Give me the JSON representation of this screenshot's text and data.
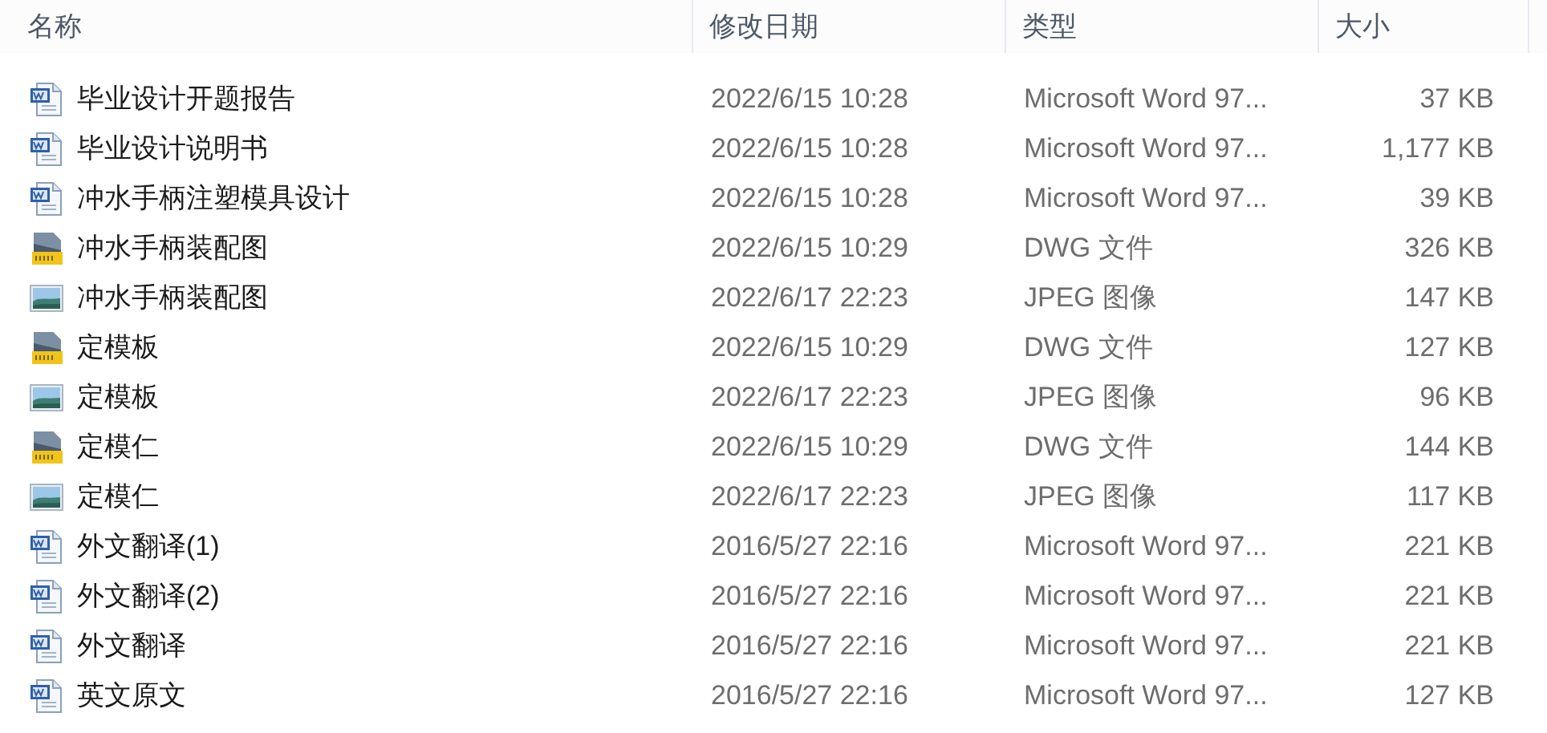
{
  "columns": [
    "名称",
    "修改日期",
    "类型",
    "大小"
  ],
  "files": [
    {
      "kind": "word",
      "name": "毕业设计开题报告",
      "modified": "2022/6/15 10:28",
      "type": "Microsoft Word 97...",
      "size": "37 KB"
    },
    {
      "kind": "word",
      "name": "毕业设计说明书",
      "modified": "2022/6/15 10:28",
      "type": "Microsoft Word 97...",
      "size": "1,177 KB"
    },
    {
      "kind": "word",
      "name": "冲水手柄注塑模具设计",
      "modified": "2022/6/15 10:28",
      "type": "Microsoft Word 97...",
      "size": "39 KB"
    },
    {
      "kind": "dwg",
      "name": "冲水手柄装配图",
      "modified": "2022/6/15 10:29",
      "type": "DWG 文件",
      "size": "326 KB"
    },
    {
      "kind": "jpeg",
      "name": "冲水手柄装配图",
      "modified": "2022/6/17 22:23",
      "type": "JPEG 图像",
      "size": "147 KB"
    },
    {
      "kind": "dwg",
      "name": "定模板",
      "modified": "2022/6/15 10:29",
      "type": "DWG 文件",
      "size": "127 KB"
    },
    {
      "kind": "jpeg",
      "name": "定模板",
      "modified": "2022/6/17 22:23",
      "type": "JPEG 图像",
      "size": "96 KB"
    },
    {
      "kind": "dwg",
      "name": "定模仁",
      "modified": "2022/6/15 10:29",
      "type": "DWG 文件",
      "size": "144 KB"
    },
    {
      "kind": "jpeg",
      "name": "定模仁",
      "modified": "2022/6/17 22:23",
      "type": "JPEG 图像",
      "size": "117 KB"
    },
    {
      "kind": "word",
      "name": "外文翻译(1)",
      "modified": "2016/5/27 22:16",
      "type": "Microsoft Word 97...",
      "size": "221 KB"
    },
    {
      "kind": "word",
      "name": "外文翻译(2)",
      "modified": "2016/5/27 22:16",
      "type": "Microsoft Word 97...",
      "size": "221 KB"
    },
    {
      "kind": "word",
      "name": "外文翻译",
      "modified": "2016/5/27 22:16",
      "type": "Microsoft Word 97...",
      "size": "221 KB"
    },
    {
      "kind": "word",
      "name": "英文原文",
      "modified": "2016/5/27 22:16",
      "type": "Microsoft Word 97...",
      "size": "127 KB"
    }
  ]
}
